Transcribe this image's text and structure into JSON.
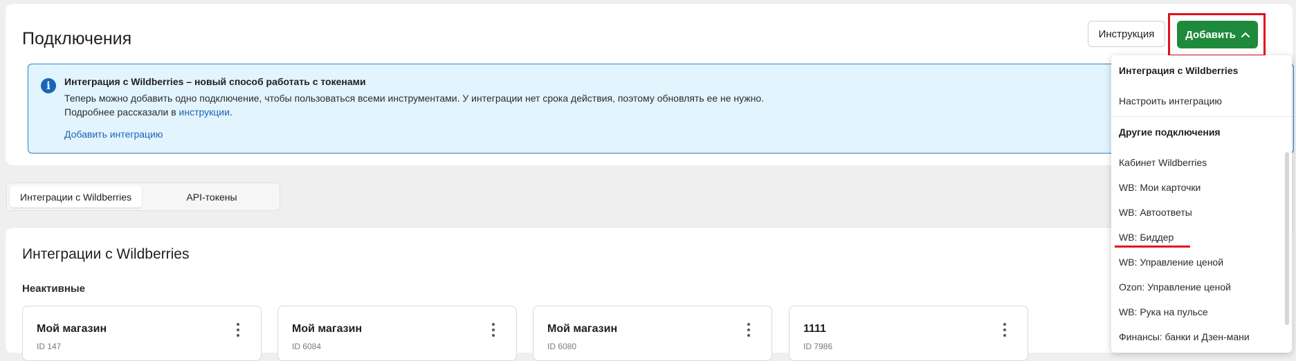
{
  "header": {
    "title": "Подключения",
    "instruction_label": "Инструкция",
    "add_label": "Добавить"
  },
  "info": {
    "icon": "info-icon",
    "title": "Интеграция с Wildberries – новый способ работать с токенами",
    "line1": "Теперь можно добавить одно подключение, чтобы пользоваться всеми инструментами. У интеграции нет срока действия, поэтому обновлять ее не нужно.",
    "line2_prefix": "Подробнее рассказали в ",
    "line2_link": "инструкции",
    "line2_suffix": ".",
    "add_link": "Добавить интеграцию"
  },
  "tabs": [
    {
      "label": "Интеграции с Wildberries",
      "active": true
    },
    {
      "label": "API-токены",
      "active": false
    }
  ],
  "section": {
    "title": "Интеграции с Wildberries",
    "subsection": "Неактивные",
    "cards": [
      {
        "name": "Мой магазин",
        "id": "ID 147"
      },
      {
        "name": "Мой магазин",
        "id": "ID 6084"
      },
      {
        "name": "Мой магазин",
        "id": "ID 6080"
      },
      {
        "name": "1111",
        "id": "ID 7986"
      }
    ]
  },
  "dropdown": {
    "group1_header": "Интеграция с Wildberries",
    "group1_items": [
      "Настроить интеграцию"
    ],
    "group2_header": "Другие подключения",
    "group2_items": [
      "Кабинет Wildberries",
      "WB: Мои карточки",
      "WB: Автоответы",
      "WB: Биддер",
      "WB: Управление ценой",
      "Ozon: Управление ценой",
      "WB: Рука на пульсе",
      "Финансы: банки и Дзен-мани"
    ]
  },
  "colors": {
    "primary_green": "#1f8a3c",
    "highlight_red": "#e0101e",
    "info_bg": "#e2f4fd",
    "info_border": "#2b7fc2",
    "link": "#1d63b8"
  }
}
